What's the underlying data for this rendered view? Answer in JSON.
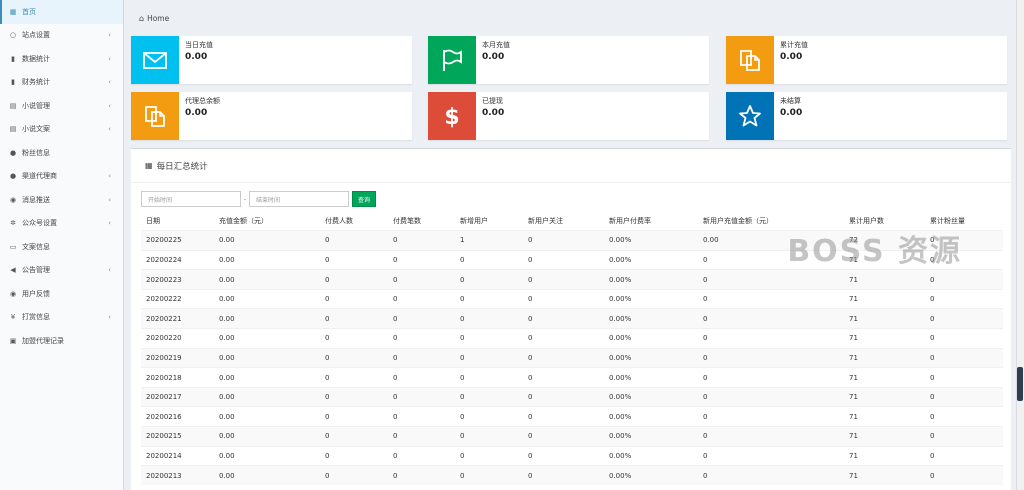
{
  "sidebar": {
    "items": [
      {
        "label": "首页",
        "icon": "dashboard-icon",
        "glyph": "▦",
        "chevron": ""
      },
      {
        "label": "站点设置",
        "icon": "circle-icon",
        "glyph": "○",
        "chevron": "‹"
      },
      {
        "label": "数据统计",
        "icon": "bar-chart-icon",
        "glyph": "▮",
        "chevron": "‹"
      },
      {
        "label": "财务统计",
        "icon": "bar-chart-icon",
        "glyph": "▮",
        "chevron": "‹"
      },
      {
        "label": "小说管理",
        "icon": "book-icon",
        "glyph": "▤",
        "chevron": "‹"
      },
      {
        "label": "小说文案",
        "icon": "book-icon",
        "glyph": "▤",
        "chevron": "‹"
      },
      {
        "label": "粉丝信息",
        "icon": "users-icon",
        "glyph": "●",
        "chevron": ""
      },
      {
        "label": "渠道代理商",
        "icon": "user-plus-icon",
        "glyph": "●",
        "chevron": "‹"
      },
      {
        "label": "消息推送",
        "icon": "comment-icon",
        "glyph": "◉",
        "chevron": "‹"
      },
      {
        "label": "公众号设置",
        "icon": "cogs-icon",
        "glyph": "✲",
        "chevron": "‹"
      },
      {
        "label": "文案信息",
        "icon": "newspaper-icon",
        "glyph": "▭",
        "chevron": ""
      },
      {
        "label": "公告管理",
        "icon": "bullhorn-icon",
        "glyph": "◀",
        "chevron": "‹"
      },
      {
        "label": "用户反馈",
        "icon": "comment-icon",
        "glyph": "◉",
        "chevron": ""
      },
      {
        "label": "打赏信息",
        "icon": "yen-icon",
        "glyph": "¥",
        "chevron": "‹"
      },
      {
        "label": "加盟代理记录",
        "icon": "id-card-icon",
        "glyph": "▣",
        "chevron": ""
      }
    ]
  },
  "breadcrumb": {
    "icon": "home-icon",
    "label": "Home"
  },
  "stat_boxes": [
    {
      "title": "当日充值",
      "value": "0.00",
      "color": "#00c0ef",
      "icon": "envelope-icon"
    },
    {
      "title": "本月充值",
      "value": "0.00",
      "color": "#00a65a",
      "icon": "flag-icon"
    },
    {
      "title": "累计充值",
      "value": "0.00",
      "color": "#f39c12",
      "icon": "copy-icon"
    },
    {
      "title": "代理总余额",
      "value": "0.00",
      "color": "#f39c12",
      "icon": "copy-icon"
    },
    {
      "title": "已提现",
      "value": "0.00",
      "color": "#dd4b39",
      "icon": "dollar-icon"
    },
    {
      "title": "未结算",
      "value": "0.00",
      "color": "#0073b7",
      "icon": "star-icon"
    }
  ],
  "panel": {
    "title": "每日汇总统计",
    "icon": "calendar-icon"
  },
  "filters": {
    "start_placeholder": "开始时间",
    "separator": "-",
    "end_placeholder": "结束时间",
    "query_label": "查询"
  },
  "table": {
    "headers": [
      "日期",
      "充值金额（元）",
      "付费人数",
      "付费笔数",
      "新增用户",
      "新用户关注",
      "新用户付费率",
      "新用户充值金额（元）",
      "累计用户数",
      "累计粉丝量"
    ],
    "rows": [
      [
        "20200225",
        "0.00",
        "0",
        "0",
        "1",
        "0",
        "0.00%",
        "0.00",
        "72",
        "0"
      ],
      [
        "20200224",
        "0.00",
        "0",
        "0",
        "0",
        "0",
        "0.00%",
        "0",
        "71",
        "0"
      ],
      [
        "20200223",
        "0.00",
        "0",
        "0",
        "0",
        "0",
        "0.00%",
        "0",
        "71",
        "0"
      ],
      [
        "20200222",
        "0.00",
        "0",
        "0",
        "0",
        "0",
        "0.00%",
        "0",
        "71",
        "0"
      ],
      [
        "20200221",
        "0.00",
        "0",
        "0",
        "0",
        "0",
        "0.00%",
        "0",
        "71",
        "0"
      ],
      [
        "20200220",
        "0.00",
        "0",
        "0",
        "0",
        "0",
        "0.00%",
        "0",
        "71",
        "0"
      ],
      [
        "20200219",
        "0.00",
        "0",
        "0",
        "0",
        "0",
        "0.00%",
        "0",
        "71",
        "0"
      ],
      [
        "20200218",
        "0.00",
        "0",
        "0",
        "0",
        "0",
        "0.00%",
        "0",
        "71",
        "0"
      ],
      [
        "20200217",
        "0.00",
        "0",
        "0",
        "0",
        "0",
        "0.00%",
        "0",
        "71",
        "0"
      ],
      [
        "20200216",
        "0.00",
        "0",
        "0",
        "0",
        "0",
        "0.00%",
        "0",
        "71",
        "0"
      ],
      [
        "20200215",
        "0.00",
        "0",
        "0",
        "0",
        "0",
        "0.00%",
        "0",
        "71",
        "0"
      ],
      [
        "20200214",
        "0.00",
        "0",
        "0",
        "0",
        "0",
        "0.00%",
        "0",
        "71",
        "0"
      ],
      [
        "20200213",
        "0.00",
        "0",
        "0",
        "0",
        "0",
        "0.00%",
        "0",
        "71",
        "0"
      ]
    ]
  },
  "watermark": "BOSS 资源"
}
